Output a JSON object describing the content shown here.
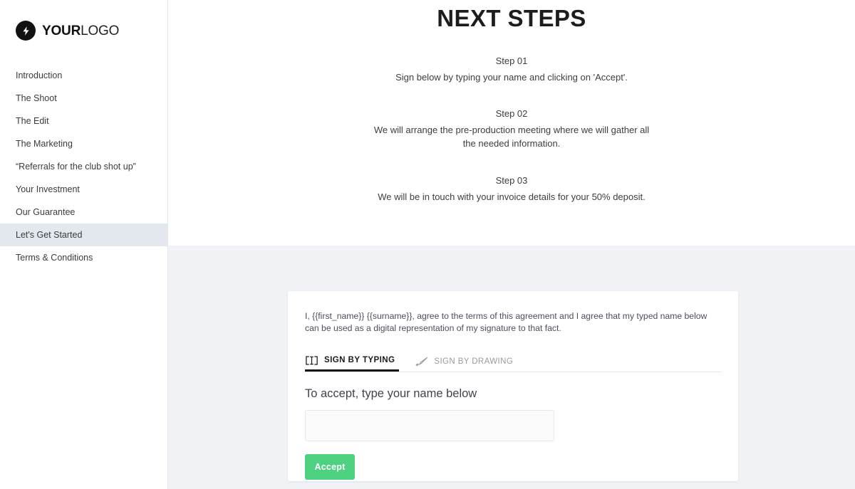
{
  "sidebar": {
    "logo": {
      "icon": "lightning-bolt-icon",
      "text_bold": "YOUR",
      "text_light": "LOGO"
    },
    "items": [
      {
        "label": "Introduction",
        "active": false
      },
      {
        "label": "The Shoot",
        "active": false
      },
      {
        "label": "The Edit",
        "active": false
      },
      {
        "label": "The Marketing",
        "active": false
      },
      {
        "label": "“Referrals for the club shot up”",
        "active": false
      },
      {
        "label": "Your Investment",
        "active": false
      },
      {
        "label": "Our Guarantee",
        "active": false
      },
      {
        "label": "Let's Get Started",
        "active": true
      },
      {
        "label": "Terms & Conditions",
        "active": false
      }
    ]
  },
  "main": {
    "title": "NEXT STEPS",
    "steps": [
      {
        "label": "Step 01",
        "description": "Sign below by typing your name and clicking on 'Accept'."
      },
      {
        "label": "Step 02",
        "description": "We will arrange the pre-production meeting where we will gather all the needed information."
      },
      {
        "label": "Step 03",
        "description": "We will be in touch with your invoice details for your 50% deposit."
      }
    ]
  },
  "sign_card": {
    "agreement_text": "I, {{first_name}} {{surname}}, agree to the terms of this agreement and I agree that my typed name below can be used as a digital representation of my signature to that fact.",
    "tabs": [
      {
        "label": "SIGN BY TYPING",
        "icon": "text-cursor-icon",
        "active": true
      },
      {
        "label": "SIGN BY DRAWING",
        "icon": "pen-nib-icon",
        "active": false
      }
    ],
    "field_label": "To accept, type your name below",
    "name_input": {
      "value": "",
      "placeholder": ""
    },
    "accept_label": "Accept"
  },
  "colors": {
    "accent_green": "#4ed181",
    "active_nav_bg": "#e3e7ee",
    "panel_bg": "#f1f2f6",
    "card_bg": "#ffffff",
    "logo_black": "#111111"
  }
}
